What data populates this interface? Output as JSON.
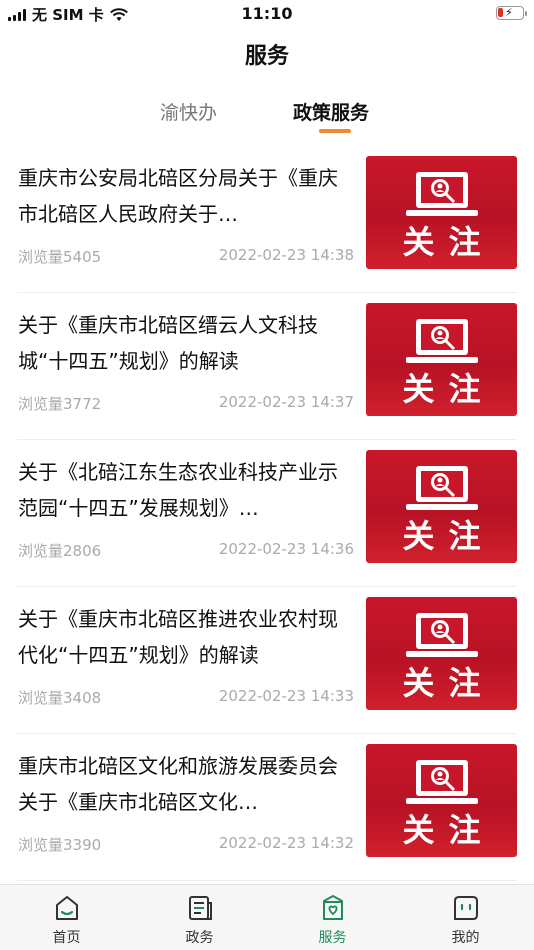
{
  "status_bar": {
    "carrier": "无 SIM 卡",
    "time": "11:10"
  },
  "header": {
    "title": "服务"
  },
  "tabs": [
    {
      "label": "渝快办",
      "active": false
    },
    {
      "label": "政策服务",
      "active": true
    }
  ],
  "colors": {
    "accent": "#f08a2b",
    "nav_active": "#1f8a5a",
    "thumb_red": "#c8172a"
  },
  "articles": [
    {
      "title": "重庆市公安局北碚区分局关于《重庆市北碚区人民政府关于…",
      "views": "浏览量5405",
      "date": "2022-02-23 14:38",
      "thumb_text": "关注"
    },
    {
      "title": "关于《重庆市北碚区缙云人文科技城“十四五”规划》的解读",
      "views": "浏览量3772",
      "date": "2022-02-23 14:37",
      "thumb_text": "关注"
    },
    {
      "title": "关于《北碚江东生态农业科技产业示范园“十四五”发展规划》…",
      "views": "浏览量2806",
      "date": "2022-02-23 14:36",
      "thumb_text": "关注"
    },
    {
      "title": "关于《重庆市北碚区推进农业农村现代化“十四五”规划》的解读",
      "views": "浏览量3408",
      "date": "2022-02-23 14:33",
      "thumb_text": "关注"
    },
    {
      "title": "重庆市北碚区文化和旅游发展委员会关于《重庆市北碚区文化…",
      "views": "浏览量3390",
      "date": "2022-02-23 14:32",
      "thumb_text": "关注"
    }
  ],
  "bottom_nav": [
    {
      "label": "首页",
      "icon": "home-icon",
      "active": false
    },
    {
      "label": "政务",
      "icon": "document-icon",
      "active": false
    },
    {
      "label": "服务",
      "icon": "service-icon",
      "active": true
    },
    {
      "label": "我的",
      "icon": "profile-icon",
      "active": false
    }
  ]
}
